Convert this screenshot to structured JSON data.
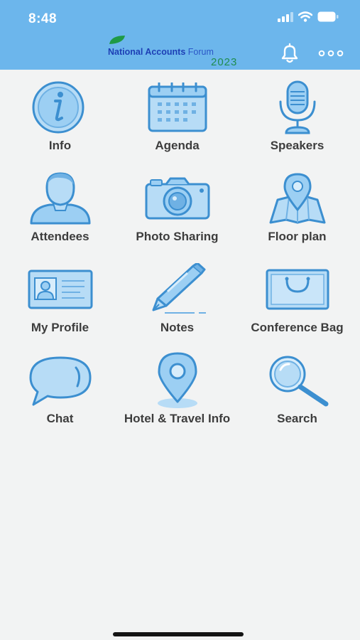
{
  "status_bar": {
    "time": "8:48"
  },
  "header": {
    "logo_text_bold": "National Accounts",
    "logo_text_light": "Forum",
    "logo_year": "2023",
    "notification_icon": "bell-icon",
    "more_icon": "more-dots-icon"
  },
  "colors": {
    "header_bg": "#6cb6ec",
    "icon_fill": "#9ccff3",
    "icon_stroke": "#3c8fd0",
    "background": "#f2f3f3",
    "label": "#3d3d3d"
  },
  "menu": [
    {
      "label": "Info",
      "icon": "info-icon"
    },
    {
      "label": "Agenda",
      "icon": "calendar-icon"
    },
    {
      "label": "Speakers",
      "icon": "microphone-icon"
    },
    {
      "label": "Attendees",
      "icon": "person-icon"
    },
    {
      "label": "Photo Sharing",
      "icon": "camera-icon"
    },
    {
      "label": "Floor plan",
      "icon": "map-pin-icon"
    },
    {
      "label": "My Profile",
      "icon": "id-card-icon"
    },
    {
      "label": "Notes",
      "icon": "pen-icon"
    },
    {
      "label": "Conference Bag",
      "icon": "bag-icon"
    },
    {
      "label": "Chat",
      "icon": "chat-bubble-icon"
    },
    {
      "label": "Hotel & Travel Info",
      "icon": "location-pin-icon"
    },
    {
      "label": "Search",
      "icon": "magnifier-icon"
    }
  ]
}
